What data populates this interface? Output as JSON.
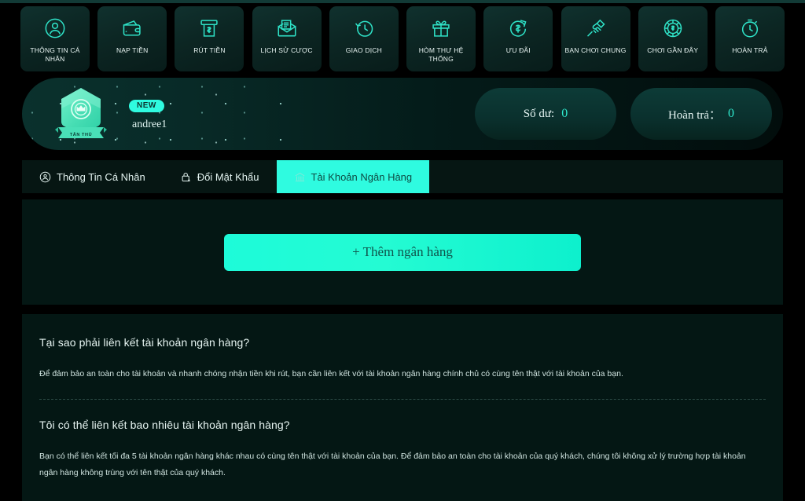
{
  "nav": {
    "items": [
      {
        "label": "THÔNG TIN CÁ NHÂN",
        "icon": "user-circle-icon"
      },
      {
        "label": "NẠP TIỀN",
        "icon": "wallet-icon"
      },
      {
        "label": "RÚT TIỀN",
        "icon": "atm-cash-icon"
      },
      {
        "label": "LỊCH SỬ CƯỢC",
        "icon": "mail-document-icon"
      },
      {
        "label": "GIAO DỊCH",
        "icon": "clock-history-icon"
      },
      {
        "label": "HÒM THƯ HỆ THỐNG",
        "icon": "gift-icon"
      },
      {
        "label": "ƯU ĐÃI",
        "icon": "refund-dollar-icon"
      },
      {
        "label": "BẠN CHƠI CHUNG",
        "icon": "handshake-icon"
      },
      {
        "label": "CHƠI GẦN ĐÂY",
        "icon": "casino-chip-icon"
      },
      {
        "label": "HOÀN TRẢ",
        "icon": "stopwatch-icon"
      }
    ]
  },
  "banner": {
    "badge_icon": "crown-shield-badge-icon",
    "badge_ribbon": "TÂN THỦ",
    "new_pill": "NEW",
    "username": "andree1",
    "balances": [
      {
        "label": "Số dư:",
        "value": "0",
        "name": "balance-card"
      },
      {
        "label": "Hoàn trả：",
        "value": "0",
        "name": "rebate-card"
      }
    ]
  },
  "tabs": [
    {
      "label": "Thông Tin Cá Nhân",
      "icon": "user-circle-icon",
      "active": false
    },
    {
      "label": "Đổi Mật Khẩu",
      "icon": "lock-key-icon",
      "active": false
    },
    {
      "label": "Tài Khoản Ngân Hàng",
      "icon": "bank-icon",
      "active": true
    }
  ],
  "panel": {
    "add_bank_label": "+ Thêm ngân hàng"
  },
  "faq": [
    {
      "question": "Tại sao phải liên kết tài khoản ngân hàng?",
      "answer": "Để đảm bảo an toàn cho tài khoản và nhanh chóng nhận tiền khi rút, bạn cần liên kết với tài khoản ngân hàng chính chủ có cùng tên thật với tài khoản của bạn."
    },
    {
      "question": "Tôi có thể liên kết bao nhiêu tài khoản ngân hàng?",
      "answer": "Bạn có thể liên kết tối đa 5 tài khoản ngân hàng khác nhau có cùng tên thật với tài khoản của bạn. Để đảm bảo an toàn cho tài khoản của quý khách, chúng tôi không xử lý trường hợp tài khoản ngân hàng không trùng với tên thật của quý khách."
    }
  ],
  "colors": {
    "accent": "#2ffbe0",
    "panel_bg": "#041714",
    "page_bg": "#000000",
    "text": "#e6f4f1"
  }
}
